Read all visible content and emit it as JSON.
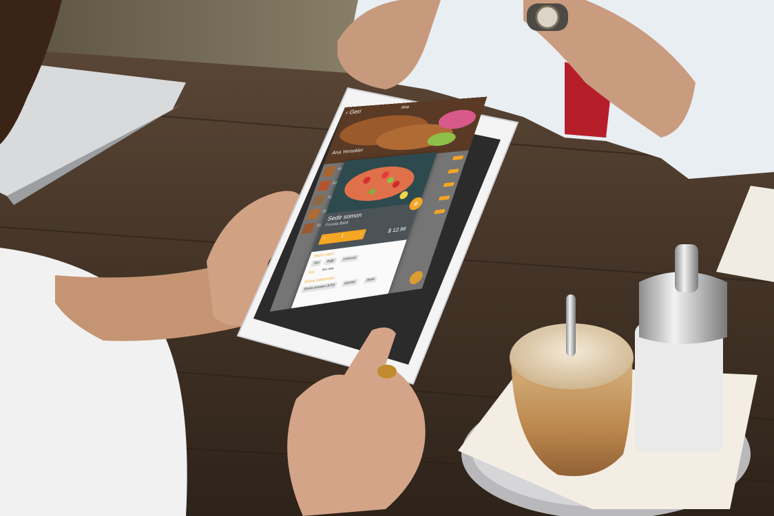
{
  "app": {
    "back_label": "Geri",
    "header_title": "Ana",
    "hero_caption": "Ana Yemekler"
  },
  "menu_list": [
    {
      "title": "Köz...",
      "sub": ""
    },
    {
      "title": "Kaşarlı",
      "sub": ""
    },
    {
      "title": "Izgara",
      "sub": ""
    },
    {
      "title": "Sebze",
      "sub": ""
    },
    {
      "title": "Köfte",
      "sub": ""
    }
  ],
  "product": {
    "name": "Sedir somon",
    "subtitle": "Fırında Balık",
    "quantity": "1",
    "price": "$ 12.96",
    "sections": [
      {
        "title": "Seçim yapın",
        "chips": [
          "Tam",
          "Buğu",
          "Limonsuz"
        ]
      },
      {
        "title": "Sos",
        "chips": [
          "Sos ekle"
        ]
      },
      {
        "title": "Ekstra malzemeler",
        "chips": [
          "Ekstra domates ($.50)",
          "Garnitür",
          "Zeytin"
        ]
      }
    ]
  },
  "colors": {
    "accent": "#f5a623",
    "panel": "#4c5358",
    "table_wood": "#4a3a2c"
  }
}
